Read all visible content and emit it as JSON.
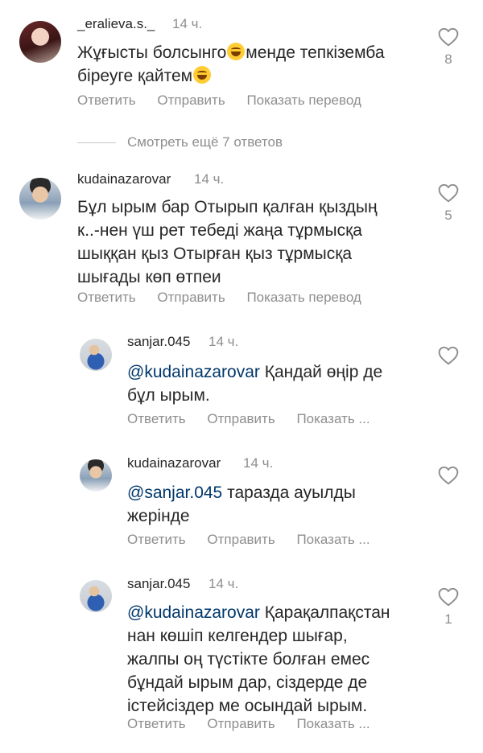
{
  "comments": [
    {
      "username": "_eralieva.s._",
      "time": "14 ч.",
      "line1": "Жұғысты болсынго",
      "line1b": "менде тепкіземба",
      "line2": "біреуге қайтем",
      "likes": "8",
      "reply": "Ответить",
      "send": "Отправить",
      "translate": "Показать перевод"
    },
    {
      "username": "kudainazarovar",
      "time": "14 ч.",
      "lines": [
        "Бұл ырым бар Отырып қалған қыздың",
        "к..-нен үш рет тебеді жаңа тұрмысқа",
        "шыққан қыз Отырған қыз тұрмысқа",
        "шығады  көп өтпеи"
      ],
      "likes": "5",
      "reply": "Ответить",
      "send": "Отправить",
      "translate": "Показать перевод"
    }
  ],
  "view_more": "Смотреть ещё 7 ответов",
  "replies": [
    {
      "username": "sanjar.045",
      "time": "14 ч.",
      "mention": "@kudainazarovar",
      "first": " Қандай өңір де",
      "lines": [
        "бұл ырым."
      ],
      "likes": "",
      "reply": "Ответить",
      "send": "Отправить",
      "translate": "Показать ..."
    },
    {
      "username": "kudainazarovar",
      "time": "14 ч.",
      "mention": "@sanjar.045",
      "first": " таразда ауылды",
      "lines": [
        "жерінде"
      ],
      "likes": "",
      "reply": "Ответить",
      "send": "Отправить",
      "translate": "Показать ..."
    },
    {
      "username": "sanjar.045",
      "time": "14 ч.",
      "mention": "@kudainazarovar",
      "first": " Қарақалпақстан",
      "lines": [
        "нан көшіп келгендер шығар,",
        "жалпы оң түстікте болған емес",
        "бұндай ырым дар, сіздерде де",
        "істейсіздер ме осындай ырым."
      ],
      "likes": "1",
      "reply": "Ответить",
      "send": "Отправить",
      "translate": "Показать ..."
    }
  ],
  "icons": {
    "heart": "heart-icon",
    "emoji": "grinning-sweat-emoji"
  },
  "colors": {
    "text": "#262626",
    "muted": "#8e8e8e",
    "mention": "#00376b"
  }
}
